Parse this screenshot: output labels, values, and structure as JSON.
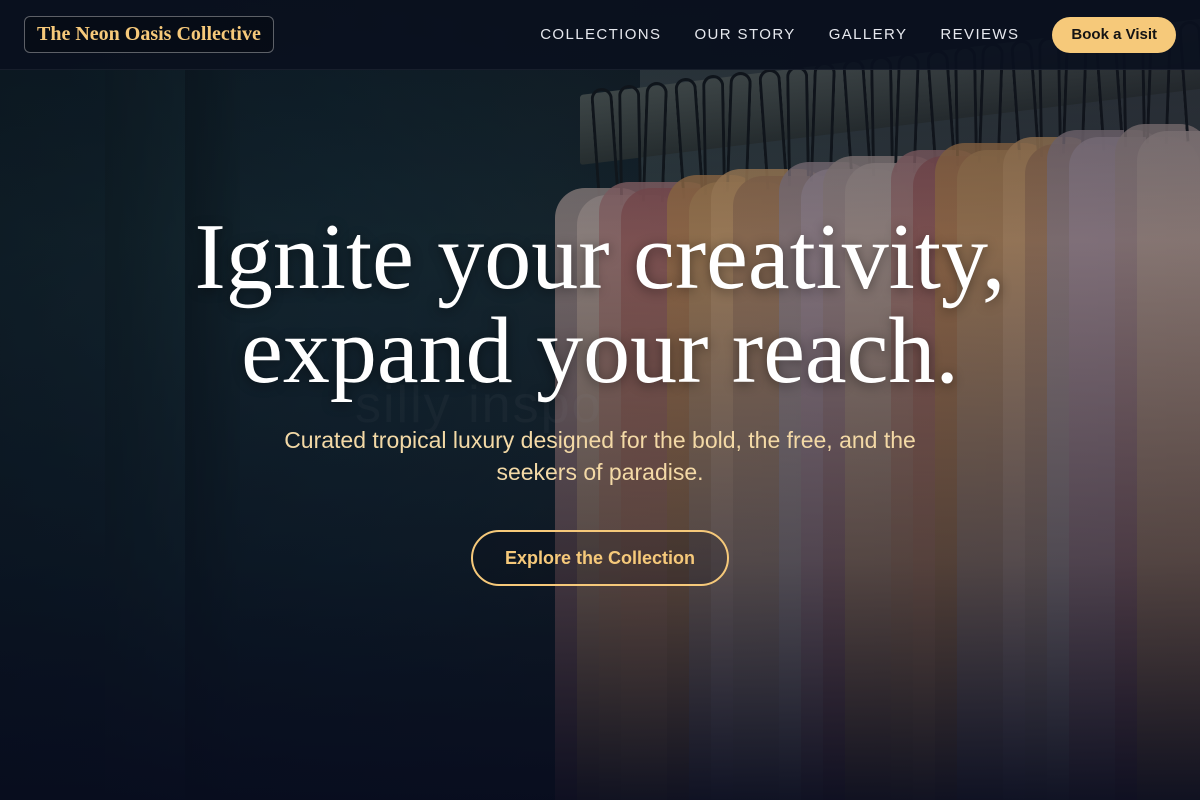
{
  "nav": {
    "logo": "The Neon Oasis Collective",
    "links": [
      "COLLECTIONS",
      "OUR STORY",
      "GALLERY",
      "REVIEWS"
    ],
    "cta_label": "Book a Visit"
  },
  "hero": {
    "headline_line1": "Ignite your creativity,",
    "headline_line2": "expand your reach.",
    "subtitle": "Curated tropical luxury designed for the bold, the free, and the seekers of paradise.",
    "cta_label": "Explore the Collection"
  },
  "colors": {
    "accent": "#f6c97a",
    "nav_background": "#0a101e",
    "headline": "#ffffff",
    "subtitle": "#f3d9a6"
  },
  "icons": {
    "background_photo": "clothes-rack-photo"
  }
}
